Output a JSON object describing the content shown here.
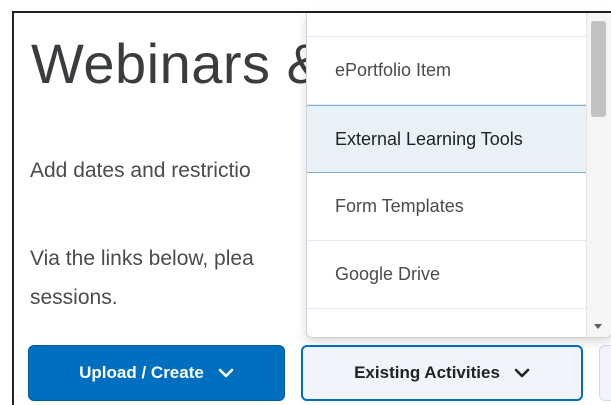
{
  "page": {
    "title": "Webinars &",
    "paragraph1": "Add dates and restrictio",
    "paragraph2_line1": "Via the links below, plea",
    "paragraph2_line2": "sessions."
  },
  "dropdown": {
    "items": [
      {
        "label": ""
      },
      {
        "label": "ePortfolio Item"
      },
      {
        "label": "External Learning Tools",
        "highlighted": true
      },
      {
        "label": "Form Templates"
      },
      {
        "label": "Google Drive"
      },
      {
        "label": ""
      }
    ]
  },
  "buttons": {
    "upload_create": "Upload / Create",
    "existing_activities": "Existing Activities"
  },
  "icons": {
    "upload_chevron": "chevron-down-icon",
    "existing_chevron": "chevron-down-icon",
    "scroll_down": "scroll-down-arrow-icon"
  },
  "colors": {
    "primary": "#006fbf",
    "secondary_bg": "#f1f5fb",
    "highlight_bg": "#e8f1f8"
  }
}
